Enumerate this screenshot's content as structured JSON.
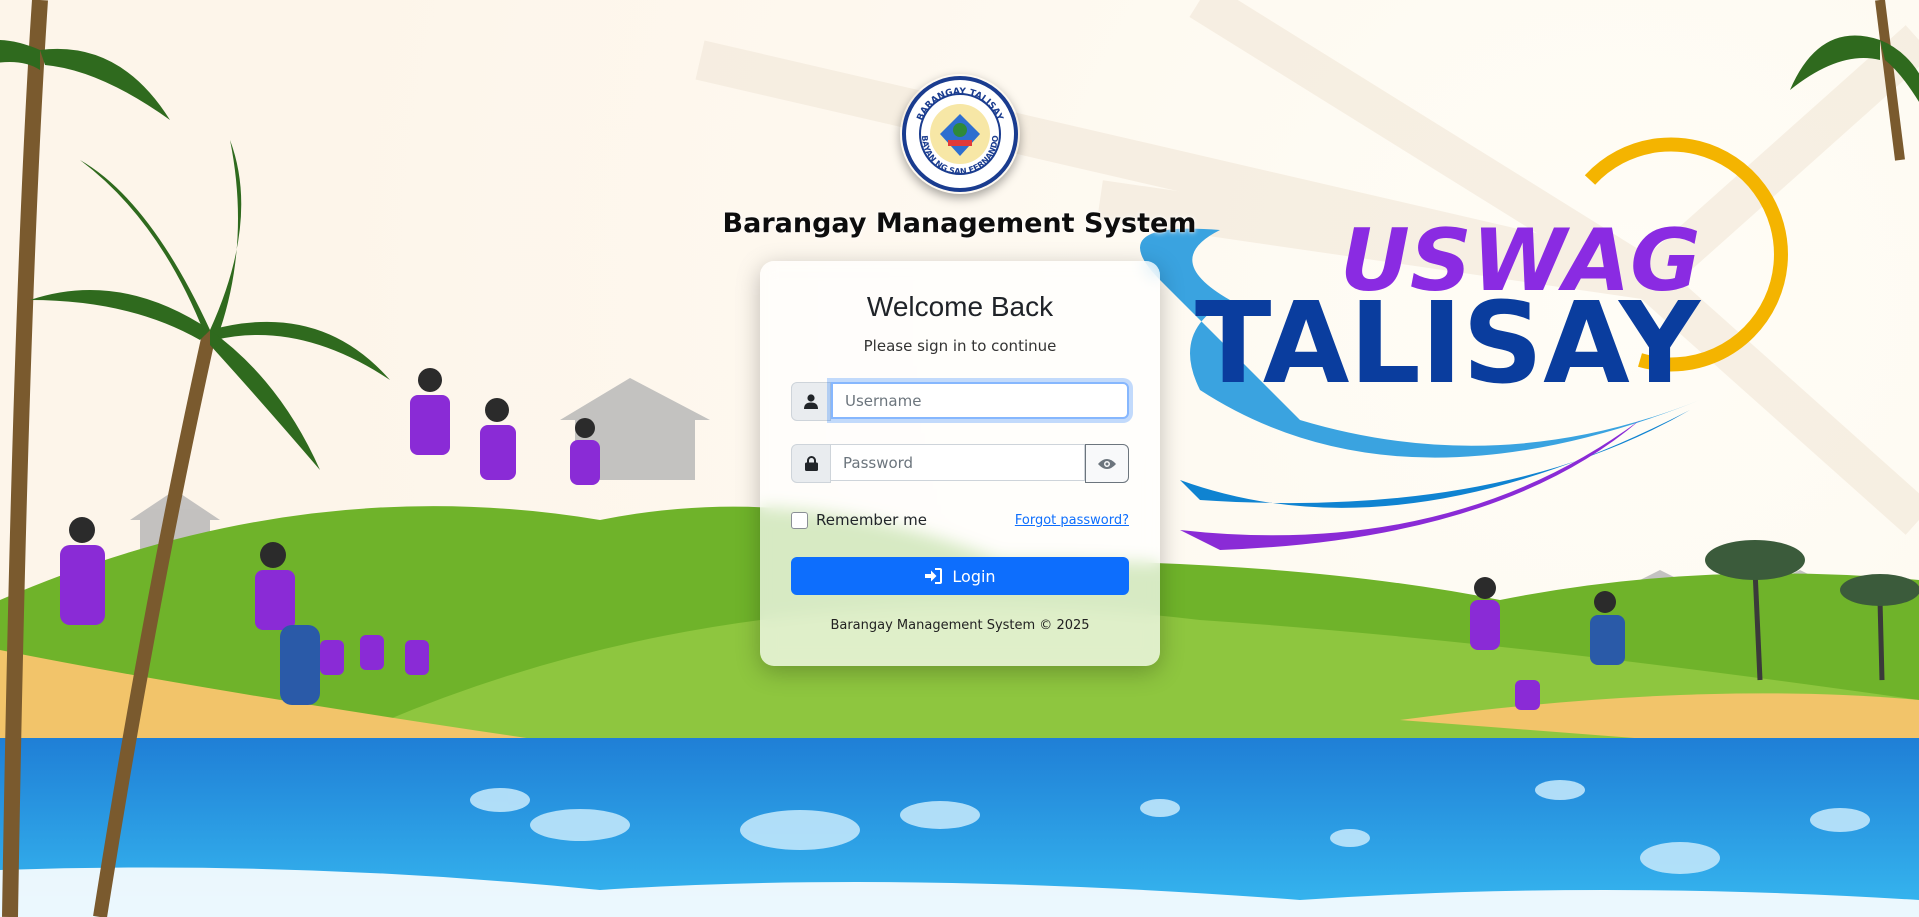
{
  "header": {
    "title": "Barangay Management System",
    "logo_icon": "barangay-seal-icon",
    "seal_text": {
      "top": "BARANGAY TALISAY",
      "bottom": "BAYAN NG SAN FERNANDO"
    }
  },
  "background": {
    "banner_line1": "USWAG",
    "banner_line2": "TALISAY"
  },
  "login": {
    "title": "Welcome Back",
    "subtitle": "Please sign in to continue",
    "username": {
      "value": "",
      "placeholder": "Username",
      "icon": "user-icon"
    },
    "password": {
      "value": "",
      "placeholder": "Password",
      "icon": "lock-icon",
      "toggle_icon": "eye-icon"
    },
    "remember_label": "Remember me",
    "remember_checked": false,
    "forgot_label": "Forgot password?",
    "submit_label": "Login",
    "submit_icon": "sign-in-icon",
    "footer": "Barangay Management System © 2025"
  },
  "colors": {
    "primary": "#0d6efd",
    "banner_purple": "#8a2be2",
    "banner_blue": "#0a3d9e"
  }
}
